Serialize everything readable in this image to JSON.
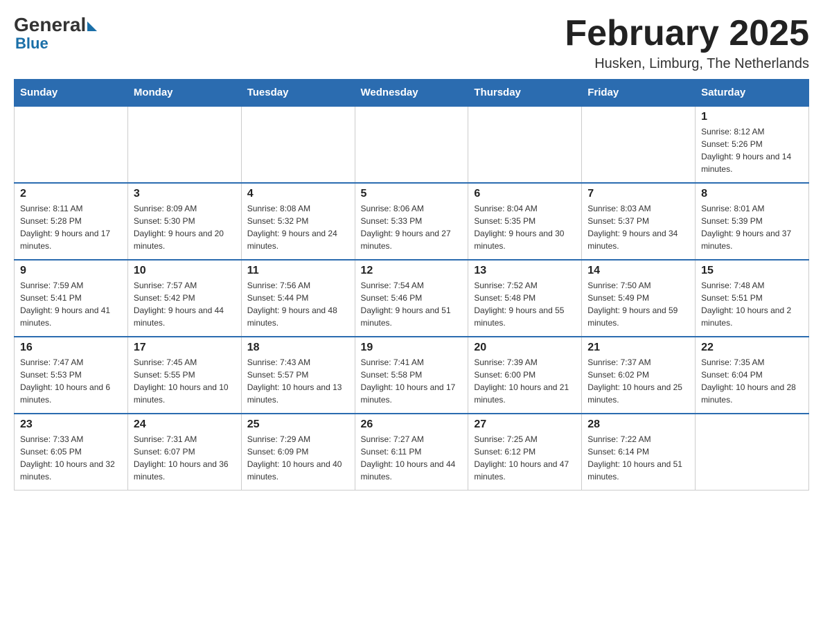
{
  "header": {
    "logo_general": "General",
    "logo_blue": "Blue",
    "month_title": "February 2025",
    "location": "Husken, Limburg, The Netherlands"
  },
  "days_of_week": [
    "Sunday",
    "Monday",
    "Tuesday",
    "Wednesday",
    "Thursday",
    "Friday",
    "Saturday"
  ],
  "weeks": [
    [
      {
        "day": "",
        "info": ""
      },
      {
        "day": "",
        "info": ""
      },
      {
        "day": "",
        "info": ""
      },
      {
        "day": "",
        "info": ""
      },
      {
        "day": "",
        "info": ""
      },
      {
        "day": "",
        "info": ""
      },
      {
        "day": "1",
        "info": "Sunrise: 8:12 AM\nSunset: 5:26 PM\nDaylight: 9 hours and 14 minutes."
      }
    ],
    [
      {
        "day": "2",
        "info": "Sunrise: 8:11 AM\nSunset: 5:28 PM\nDaylight: 9 hours and 17 minutes."
      },
      {
        "day": "3",
        "info": "Sunrise: 8:09 AM\nSunset: 5:30 PM\nDaylight: 9 hours and 20 minutes."
      },
      {
        "day": "4",
        "info": "Sunrise: 8:08 AM\nSunset: 5:32 PM\nDaylight: 9 hours and 24 minutes."
      },
      {
        "day": "5",
        "info": "Sunrise: 8:06 AM\nSunset: 5:33 PM\nDaylight: 9 hours and 27 minutes."
      },
      {
        "day": "6",
        "info": "Sunrise: 8:04 AM\nSunset: 5:35 PM\nDaylight: 9 hours and 30 minutes."
      },
      {
        "day": "7",
        "info": "Sunrise: 8:03 AM\nSunset: 5:37 PM\nDaylight: 9 hours and 34 minutes."
      },
      {
        "day": "8",
        "info": "Sunrise: 8:01 AM\nSunset: 5:39 PM\nDaylight: 9 hours and 37 minutes."
      }
    ],
    [
      {
        "day": "9",
        "info": "Sunrise: 7:59 AM\nSunset: 5:41 PM\nDaylight: 9 hours and 41 minutes."
      },
      {
        "day": "10",
        "info": "Sunrise: 7:57 AM\nSunset: 5:42 PM\nDaylight: 9 hours and 44 minutes."
      },
      {
        "day": "11",
        "info": "Sunrise: 7:56 AM\nSunset: 5:44 PM\nDaylight: 9 hours and 48 minutes."
      },
      {
        "day": "12",
        "info": "Sunrise: 7:54 AM\nSunset: 5:46 PM\nDaylight: 9 hours and 51 minutes."
      },
      {
        "day": "13",
        "info": "Sunrise: 7:52 AM\nSunset: 5:48 PM\nDaylight: 9 hours and 55 minutes."
      },
      {
        "day": "14",
        "info": "Sunrise: 7:50 AM\nSunset: 5:49 PM\nDaylight: 9 hours and 59 minutes."
      },
      {
        "day": "15",
        "info": "Sunrise: 7:48 AM\nSunset: 5:51 PM\nDaylight: 10 hours and 2 minutes."
      }
    ],
    [
      {
        "day": "16",
        "info": "Sunrise: 7:47 AM\nSunset: 5:53 PM\nDaylight: 10 hours and 6 minutes."
      },
      {
        "day": "17",
        "info": "Sunrise: 7:45 AM\nSunset: 5:55 PM\nDaylight: 10 hours and 10 minutes."
      },
      {
        "day": "18",
        "info": "Sunrise: 7:43 AM\nSunset: 5:57 PM\nDaylight: 10 hours and 13 minutes."
      },
      {
        "day": "19",
        "info": "Sunrise: 7:41 AM\nSunset: 5:58 PM\nDaylight: 10 hours and 17 minutes."
      },
      {
        "day": "20",
        "info": "Sunrise: 7:39 AM\nSunset: 6:00 PM\nDaylight: 10 hours and 21 minutes."
      },
      {
        "day": "21",
        "info": "Sunrise: 7:37 AM\nSunset: 6:02 PM\nDaylight: 10 hours and 25 minutes."
      },
      {
        "day": "22",
        "info": "Sunrise: 7:35 AM\nSunset: 6:04 PM\nDaylight: 10 hours and 28 minutes."
      }
    ],
    [
      {
        "day": "23",
        "info": "Sunrise: 7:33 AM\nSunset: 6:05 PM\nDaylight: 10 hours and 32 minutes."
      },
      {
        "day": "24",
        "info": "Sunrise: 7:31 AM\nSunset: 6:07 PM\nDaylight: 10 hours and 36 minutes."
      },
      {
        "day": "25",
        "info": "Sunrise: 7:29 AM\nSunset: 6:09 PM\nDaylight: 10 hours and 40 minutes."
      },
      {
        "day": "26",
        "info": "Sunrise: 7:27 AM\nSunset: 6:11 PM\nDaylight: 10 hours and 44 minutes."
      },
      {
        "day": "27",
        "info": "Sunrise: 7:25 AM\nSunset: 6:12 PM\nDaylight: 10 hours and 47 minutes."
      },
      {
        "day": "28",
        "info": "Sunrise: 7:22 AM\nSunset: 6:14 PM\nDaylight: 10 hours and 51 minutes."
      },
      {
        "day": "",
        "info": ""
      }
    ]
  ]
}
